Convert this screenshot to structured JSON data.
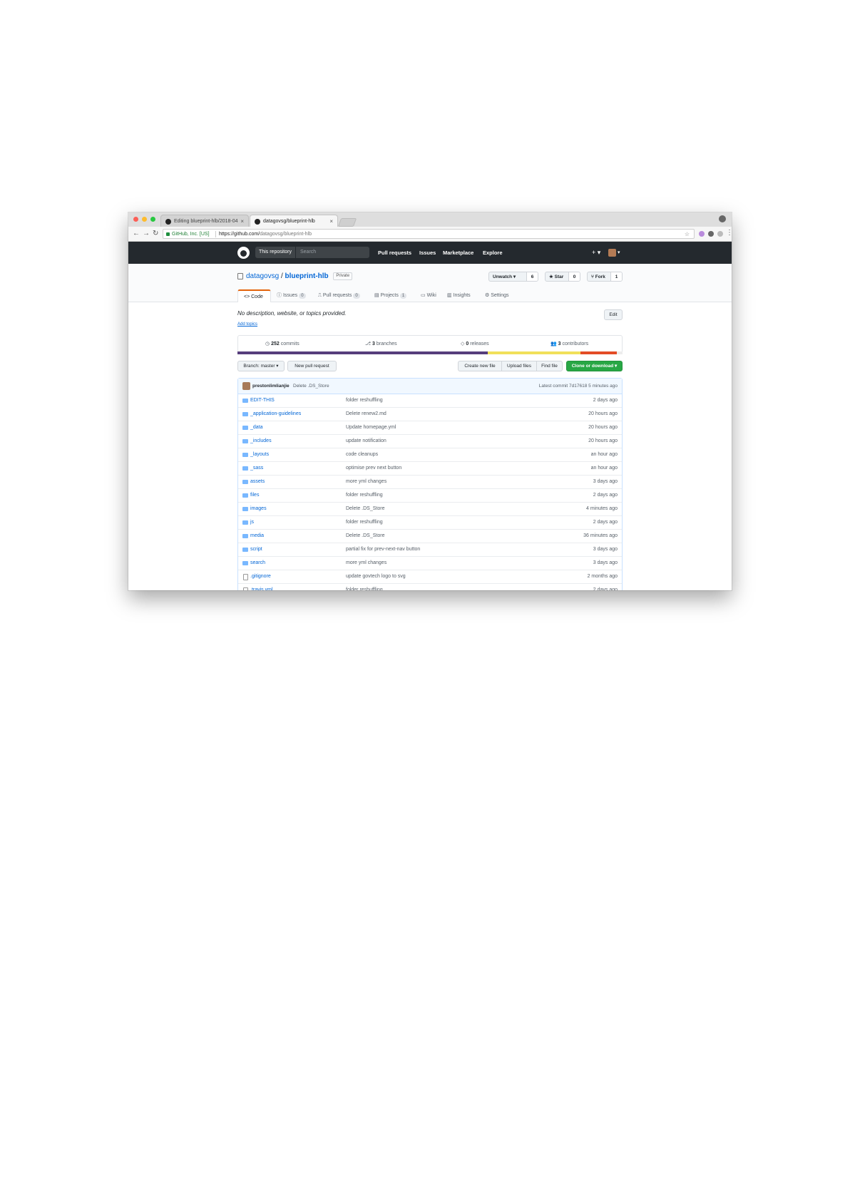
{
  "browser": {
    "tabs": [
      {
        "title": "Editing blueprint-hlb/2018-04",
        "active": false
      },
      {
        "title": "datagovsg/blueprint-hlb",
        "active": true
      }
    ],
    "secure_label": "GitHub, Inc. [US]",
    "url_host": "https://github.com/",
    "url_path": "datagovsg/blueprint-hlb"
  },
  "header": {
    "scope": "This repository",
    "search_placeholder": "Search",
    "nav": [
      "Pull requests",
      "Issues",
      "Marketplace",
      "Explore"
    ],
    "plus": "+ ▾",
    "avatar_caret": "▾"
  },
  "repo": {
    "owner": "datagovsg",
    "separator": "/",
    "name": "blueprint-hlb",
    "visibility": "Private",
    "unwatch": {
      "label": "Unwatch ▾",
      "count": "6"
    },
    "star": {
      "label": "★ Star",
      "count": "0"
    },
    "fork": {
      "label": "Fork",
      "count": "1"
    },
    "tabs": [
      {
        "label": "<> Code",
        "badge": ""
      },
      {
        "label": "Issues",
        "badge": "0"
      },
      {
        "label": "Pull requests",
        "badge": "0"
      },
      {
        "label": "Projects",
        "badge": "1"
      },
      {
        "label": "Wiki",
        "badge": ""
      },
      {
        "label": "Insights",
        "badge": ""
      },
      {
        "label": "Settings",
        "badge": ""
      }
    ]
  },
  "content": {
    "description": "No description, website, or topics provided.",
    "add_topics": "Add topics",
    "edit": "Edit",
    "summary": {
      "commits_num": "252",
      "commits_label": "commits",
      "branches_num": "3",
      "branches_label": "branches",
      "releases_num": "0",
      "releases_label": "releases",
      "contributors_num": "3",
      "contributors_label": "contributors"
    },
    "languages": [
      {
        "color": "#563d7c",
        "share": 0.65
      },
      {
        "color": "#f1e05a",
        "share": 0.24
      },
      {
        "color": "#e34c26",
        "share": 0.095
      },
      {
        "color": "#ededed",
        "share": 0.015
      }
    ],
    "branch_button": "Branch: master ▾",
    "new_pr": "New pull request",
    "create_file": "Create new file",
    "upload_files": "Upload files",
    "find_file": "Find file",
    "clone": "Clone or download ▾",
    "latest_commit": {
      "author": "prestonlimlianjie",
      "message": "Delete .DS_Store",
      "info": "Latest commit 7d17618 5 minutes ago"
    },
    "files": [
      {
        "name": "EDIT-THIS",
        "type": "dir",
        "message": "folder reshuffling",
        "age": "2 days ago"
      },
      {
        "name": "_application-guidelines",
        "type": "dir",
        "message": "Delete renew2.md",
        "age": "20 hours ago"
      },
      {
        "name": "_data",
        "type": "dir",
        "message": "Update homepage.yml",
        "age": "20 hours ago"
      },
      {
        "name": "_includes",
        "type": "dir",
        "message": "update notification",
        "age": "20 hours ago"
      },
      {
        "name": "_layouts",
        "type": "dir",
        "message": "code cleanups",
        "age": "an hour ago"
      },
      {
        "name": "_sass",
        "type": "dir",
        "message": "optimise prev next button",
        "age": "an hour ago"
      },
      {
        "name": "assets",
        "type": "dir",
        "message": "more yml changes",
        "age": "3 days ago"
      },
      {
        "name": "files",
        "type": "dir",
        "message": "folder reshuffling",
        "age": "2 days ago"
      },
      {
        "name": "images",
        "type": "dir",
        "message": "Delete .DS_Store",
        "age": "4 minutes ago"
      },
      {
        "name": "js",
        "type": "dir",
        "message": "folder reshuffling",
        "age": "2 days ago"
      },
      {
        "name": "media",
        "type": "dir",
        "message": "Delete .DS_Store",
        "age": "36 minutes ago"
      },
      {
        "name": "script",
        "type": "dir",
        "message": "partial fix for prev-next-nav button",
        "age": "3 days ago"
      },
      {
        "name": "search",
        "type": "dir",
        "message": "more yml changes",
        "age": "3 days ago"
      },
      {
        "name": ".gitignore",
        "type": "file",
        "message": "update govtech logo to svg",
        "age": "2 months ago"
      },
      {
        "name": ".travis.yml",
        "type": "file",
        "message": "folder reshuffling",
        "age": "2 days ago"
      }
    ]
  }
}
